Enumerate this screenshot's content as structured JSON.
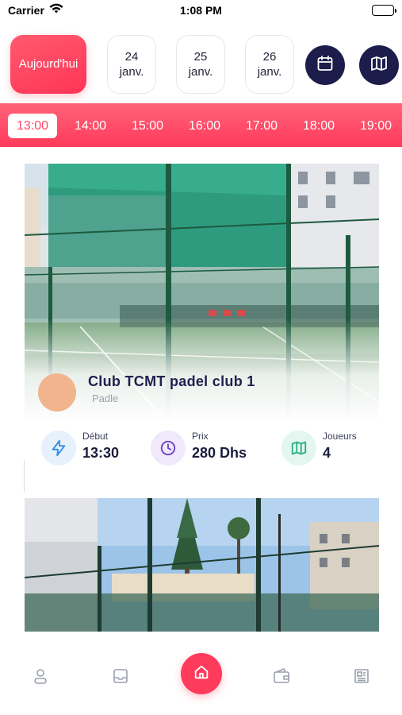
{
  "status_bar": {
    "carrier": "Carrier",
    "time": "1:08 PM"
  },
  "date_selector": {
    "items": [
      {
        "label": "Aujourd'hui",
        "active": true
      },
      {
        "label": "24\njanv.",
        "active": false
      },
      {
        "label": "25\njanv.",
        "active": false
      },
      {
        "label": "26\njanv.",
        "active": false
      }
    ],
    "calendar_icon": "calendar-icon",
    "map_icon": "map-icon"
  },
  "time_strip": {
    "selected": "13:00",
    "times": [
      "13:00",
      "14:00",
      "15:00",
      "16:00",
      "17:00",
      "18:00",
      "19:00"
    ]
  },
  "club_card": {
    "name": "Club TCMT padel club 1",
    "sport": "Padle",
    "stats": [
      {
        "label": "Début",
        "value": "13:30",
        "icon": "lightning-icon",
        "color": "#2f8de4",
        "bg": "#e6f1fc"
      },
      {
        "label": "Prix",
        "value": "280 Dhs",
        "icon": "clock-icon",
        "color": "#6a3fc4",
        "bg": "#efe9fb"
      },
      {
        "label": "Joueurs",
        "value": "4",
        "icon": "map-icon",
        "color": "#27b07f",
        "bg": "#e3f6ef"
      }
    ]
  },
  "bottom_nav": {
    "items": [
      "user-icon",
      "inbox-icon",
      "home-icon",
      "wallet-icon",
      "news-icon"
    ],
    "active": "home-icon"
  },
  "colors": {
    "accent": "#ff3b5c",
    "navy": "#1c1d4a"
  }
}
